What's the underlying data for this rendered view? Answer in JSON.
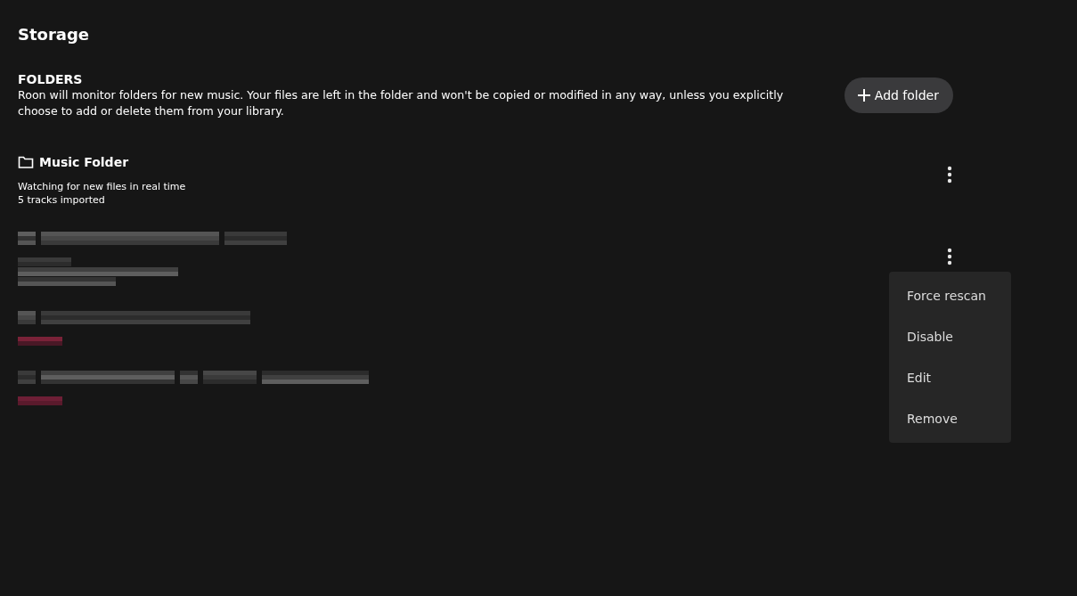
{
  "page": {
    "title": "Storage"
  },
  "folders_section": {
    "heading": "FOLDERS",
    "description": "Roon will monitor folders for new music. Your files are left in the folder and won't be copied or modified in any way, unless you explicitly choose to add or delete them from your library.",
    "add_button": "Add folder"
  },
  "folders": [
    {
      "kind": "readable",
      "name": "Music Folder",
      "details": [
        "Watching for new files in real time",
        "5 tracks imported"
      ],
      "menu_open": false
    },
    {
      "kind": "pixelated_details",
      "menu_open": true
    },
    {
      "kind": "pixelated_tagged"
    },
    {
      "kind": "pixelated_tagged"
    }
  ],
  "context_menu": {
    "items": [
      "Force rescan",
      "Disable",
      "Edit",
      "Remove"
    ]
  }
}
